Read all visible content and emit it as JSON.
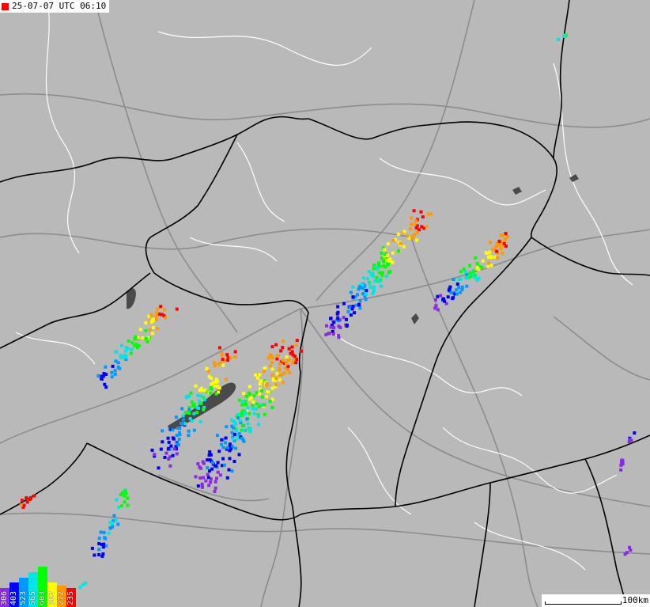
{
  "timestamp": {
    "text": "25-07-07 UTC 06:10",
    "marker_color": "#ff0000"
  },
  "scale": {
    "label": "100km"
  },
  "legend": [
    {
      "label": "306",
      "color": "#8a2be2",
      "level": 0.35
    },
    {
      "label": "403",
      "color": "#0000ff",
      "level": 0.45
    },
    {
      "label": "523",
      "color": "#0099ff",
      "level": 0.55
    },
    {
      "label": "565",
      "color": "#00e5e5",
      "level": 0.65
    },
    {
      "label": "603",
      "color": "#00ff00",
      "level": 0.75
    },
    {
      "label": "302",
      "color": "#ffff00",
      "level": 0.45
    },
    {
      "label": "272",
      "color": "#ff9900",
      "level": 0.4
    },
    {
      "label": "235",
      "color": "#ff0000",
      "level": 0.35
    }
  ],
  "colors": {
    "land": "#b9b9b9",
    "water": "#4a4a4a",
    "country_border": "#000000",
    "region_border": "#ffffff",
    "roads": "#8c8c8c"
  }
}
